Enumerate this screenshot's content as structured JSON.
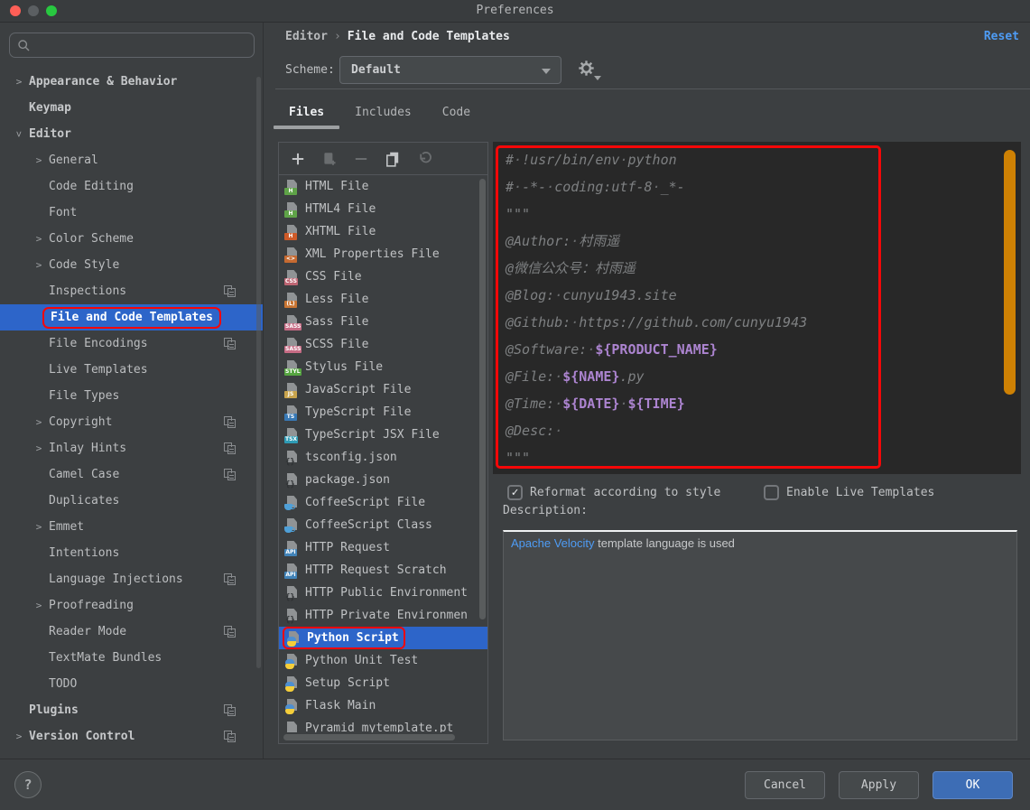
{
  "window": {
    "title": "Preferences",
    "traffic_lights": [
      "close",
      "minimize",
      "zoom"
    ]
  },
  "colors": {
    "selection_blue": "#2D65C9",
    "annotation_red": "#F50708",
    "scrollbar_orange": "#CE8104",
    "template_var_purple": "#AC84D0",
    "link_blue": "#4E9CF5",
    "ok_button_blue": "#3D6DB5"
  },
  "header": {
    "breadcrumb": [
      "Editor",
      "File and Code Templates"
    ],
    "breadcrumb_separator": "›",
    "reset_label": "Reset",
    "scheme_label": "Scheme:",
    "scheme_value": "Default"
  },
  "sidebar": {
    "search_placeholder": "",
    "help_label": "?",
    "items": [
      {
        "label": "Appearance & Behavior",
        "level": 0,
        "chevron": "right",
        "bold": true
      },
      {
        "label": "Keymap",
        "level": 0,
        "bold": true
      },
      {
        "label": "Editor",
        "level": 0,
        "chevron": "down",
        "bold": true
      },
      {
        "label": "General",
        "level": 1,
        "chevron": "right"
      },
      {
        "label": "Code Editing",
        "level": 1
      },
      {
        "label": "Font",
        "level": 1
      },
      {
        "label": "Color Scheme",
        "level": 1,
        "chevron": "right"
      },
      {
        "label": "Code Style",
        "level": 1,
        "chevron": "right"
      },
      {
        "label": "Inspections",
        "level": 1,
        "per_project": true
      },
      {
        "label": "File and Code Templates",
        "level": 1,
        "selected": true,
        "red_box": true
      },
      {
        "label": "File Encodings",
        "level": 1,
        "per_project": true
      },
      {
        "label": "Live Templates",
        "level": 1
      },
      {
        "label": "File Types",
        "level": 1
      },
      {
        "label": "Copyright",
        "level": 1,
        "chevron": "right",
        "per_project": true
      },
      {
        "label": "Inlay Hints",
        "level": 1,
        "chevron": "right",
        "per_project": true
      },
      {
        "label": "Camel Case",
        "level": 1,
        "per_project": true
      },
      {
        "label": "Duplicates",
        "level": 1
      },
      {
        "label": "Emmet",
        "level": 1,
        "chevron": "right"
      },
      {
        "label": "Intentions",
        "level": 1
      },
      {
        "label": "Language Injections",
        "level": 1,
        "per_project": true
      },
      {
        "label": "Proofreading",
        "level": 1,
        "chevron": "right"
      },
      {
        "label": "Reader Mode",
        "level": 1,
        "per_project": true
      },
      {
        "label": "TextMate Bundles",
        "level": 1
      },
      {
        "label": "TODO",
        "level": 1
      },
      {
        "label": "Plugins",
        "level": 0,
        "bold": true,
        "per_project": true
      },
      {
        "label": "Version Control",
        "level": 0,
        "chevron": "right",
        "bold": true,
        "per_project": true
      }
    ]
  },
  "tabs": [
    {
      "label": "Files",
      "active": true
    },
    {
      "label": "Includes",
      "active": false
    },
    {
      "label": "Code",
      "active": false
    }
  ],
  "file_list": {
    "toolbar": [
      {
        "name": "add",
        "enabled": true
      },
      {
        "name": "copy-template",
        "enabled": false
      },
      {
        "name": "remove",
        "enabled": false
      },
      {
        "name": "duplicate",
        "enabled": true
      },
      {
        "name": "revert",
        "enabled": false
      }
    ],
    "items": [
      {
        "label": "HTML File",
        "icon": "html"
      },
      {
        "label": "HTML4 File",
        "icon": "html"
      },
      {
        "label": "XHTML File",
        "icon": "xhtml"
      },
      {
        "label": "XML Properties File",
        "icon": "xmlprops"
      },
      {
        "label": "CSS File",
        "icon": "css"
      },
      {
        "label": "Less File",
        "icon": "less"
      },
      {
        "label": "Sass File",
        "icon": "sass"
      },
      {
        "label": "SCSS File",
        "icon": "sass"
      },
      {
        "label": "Stylus File",
        "icon": "styl"
      },
      {
        "label": "JavaScript File",
        "icon": "js"
      },
      {
        "label": "TypeScript File",
        "icon": "ts"
      },
      {
        "label": "TypeScript JSX File",
        "icon": "tsx"
      },
      {
        "label": "tsconfig.json",
        "icon": "json"
      },
      {
        "label": "package.json",
        "icon": "json"
      },
      {
        "label": "CoffeeScript File",
        "icon": "coffee"
      },
      {
        "label": "CoffeeScript Class",
        "icon": "coffee"
      },
      {
        "label": "HTTP Request",
        "icon": "api"
      },
      {
        "label": "HTTP Request Scratch",
        "icon": "api"
      },
      {
        "label": "HTTP Public Environment",
        "icon": "json"
      },
      {
        "label": "HTTP Private Environmen",
        "icon": "json"
      },
      {
        "label": "Python Script",
        "icon": "python",
        "selected": true,
        "red_box": true
      },
      {
        "label": "Python Unit Test",
        "icon": "python"
      },
      {
        "label": "Setup Script",
        "icon": "python"
      },
      {
        "label": "Flask Main",
        "icon": "python"
      },
      {
        "label": "Pyramid mytemplate.pt",
        "icon": "pyramid"
      }
    ]
  },
  "file_icons": {
    "html": {
      "badge": "H",
      "color": "#5FA348"
    },
    "xhtml": {
      "badge": "H",
      "color": "#CE5A28"
    },
    "xmlprops": {
      "badge": "<>",
      "color": "#C66A31"
    },
    "css": {
      "badge": "CSS",
      "color": "#BE6573"
    },
    "less": {
      "badge": "(L)",
      "color": "#C87533"
    },
    "sass": {
      "badge": "SASS",
      "color": "#C66B84"
    },
    "styl": {
      "badge": "STYL",
      "color": "#56A541"
    },
    "js": {
      "badge": "JS",
      "color": "#C9A44D"
    },
    "ts": {
      "badge": "TS",
      "color": "#3879B5"
    },
    "tsx": {
      "badge": "TSX",
      "color": "#2E9BB5"
    },
    "api": {
      "badge": "API",
      "color": "#4183B8"
    },
    "json": {},
    "coffee": {},
    "python": {},
    "pyramid": {}
  },
  "editor": {
    "lines": [
      [
        {
          "t": "# !usr/bin/env python",
          "c": "com"
        }
      ],
      [
        {
          "t": "# -*- coding:utf-8 _*-",
          "c": "com"
        }
      ],
      [
        {
          "t": "\"\"\"",
          "c": "com"
        }
      ],
      [
        {
          "t": "@Author: 村雨遥",
          "c": "com"
        }
      ],
      [
        {
          "t": "@微信公众号：村雨遥",
          "c": "com"
        }
      ],
      [
        {
          "t": "@Blog: cunyu1943.site",
          "c": "com"
        }
      ],
      [
        {
          "t": "@Github: https://github.com/cunyu1943",
          "c": "com"
        }
      ],
      [
        {
          "t": "@Software: ",
          "c": "com"
        },
        {
          "t": "${PRODUCT_NAME}",
          "c": "var"
        }
      ],
      [
        {
          "t": "@File: ",
          "c": "com"
        },
        {
          "t": "${NAME}",
          "c": "var"
        },
        {
          "t": ".py",
          "c": "com"
        }
      ],
      [
        {
          "t": "@Time: ",
          "c": "com"
        },
        {
          "t": "${DATE}",
          "c": "var"
        },
        {
          "t": " ",
          "c": "com"
        },
        {
          "t": "${TIME}",
          "c": "var"
        }
      ],
      [
        {
          "t": "@Desc: ",
          "c": "com"
        }
      ],
      [
        {
          "t": "\"\"\"",
          "c": "com"
        }
      ]
    ]
  },
  "options": {
    "reformat": {
      "label": "Reformat according to style",
      "checked": true
    },
    "live_templates": {
      "label": "Enable Live Templates",
      "checked": false
    }
  },
  "description": {
    "label": "Description:",
    "link_text": "Apache Velocity",
    "text": " template language is used"
  },
  "footer": {
    "buttons": [
      {
        "label": "Cancel",
        "primary": false
      },
      {
        "label": "Apply",
        "primary": false
      },
      {
        "label": "OK",
        "primary": true
      }
    ]
  }
}
